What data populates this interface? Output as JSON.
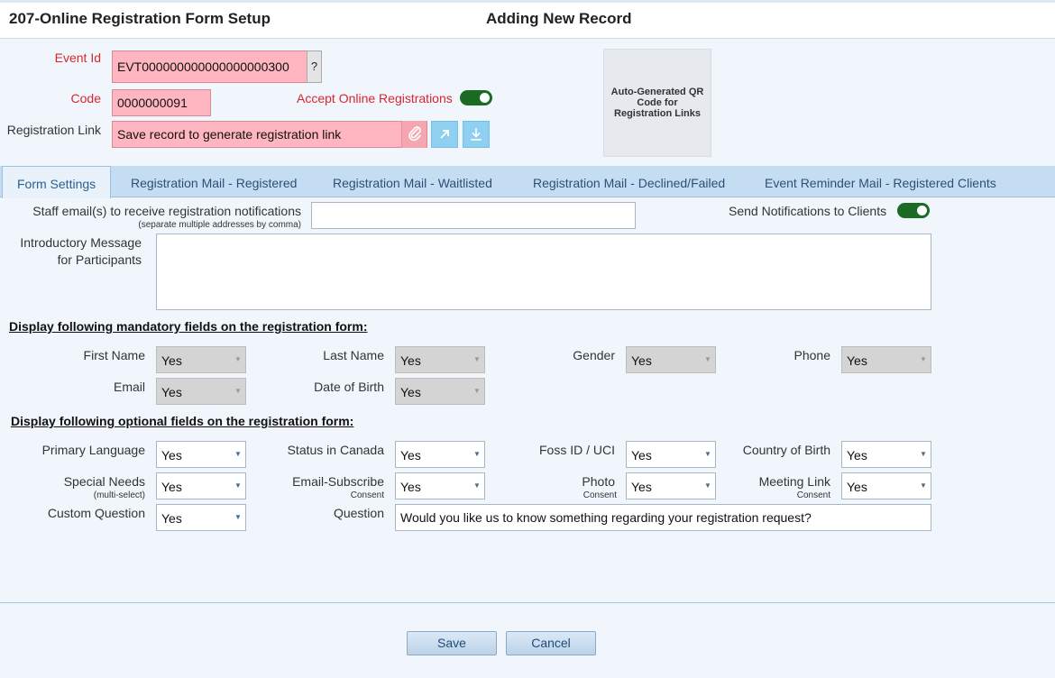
{
  "header": {
    "app_title": "207-Online Registration Form Setup",
    "mode_title": "Adding New Record"
  },
  "record": {
    "event_id_label": "Event Id",
    "event_id_value": "EVT000000000000000000300",
    "help_label": "?",
    "code_label": "Code",
    "code_value": "0000000091",
    "accept_online_label": "Accept Online Registrations",
    "accept_online_on": true,
    "reg_link_label": "Registration Link",
    "reg_link_value": "Save record to generate registration link",
    "qr_text": "Auto-Generated QR Code for Registration Links"
  },
  "tabs": [
    {
      "label": "Form Settings",
      "active": true
    },
    {
      "label": "Registration Mail - Registered",
      "active": false
    },
    {
      "label": "Registration Mail - Waitlisted",
      "active": false
    },
    {
      "label": "Registration Mail - Declined/Failed",
      "active": false
    },
    {
      "label": "Event Reminder Mail - Registered Clients",
      "active": false
    }
  ],
  "form": {
    "staff_email_label": "Staff email(s) to receive registration notifications",
    "staff_email_note": "(separate multiple addresses by comma)",
    "staff_email_value": "",
    "send_notifications_label": "Send Notifications to Clients",
    "send_notifications_on": true,
    "intro_label_1": "Introductory Message",
    "intro_label_2": "for Participants",
    "intro_value": ""
  },
  "mandatory": {
    "heading": "Display following mandatory fields on the registration form:",
    "fields": [
      {
        "label": "First Name",
        "value": "Yes"
      },
      {
        "label": "Last Name",
        "value": "Yes"
      },
      {
        "label": "Gender",
        "value": "Yes"
      },
      {
        "label": "Phone",
        "value": "Yes"
      },
      {
        "label": "Email",
        "value": "Yes"
      },
      {
        "label": "Date of Birth",
        "value": "Yes"
      }
    ]
  },
  "optional": {
    "heading": "Display following optional fields on the registration form:",
    "fields": [
      {
        "label": "Primary Language",
        "sub": "",
        "value": "Yes"
      },
      {
        "label": "Status in Canada",
        "sub": "",
        "value": "Yes"
      },
      {
        "label": "Foss ID / UCI",
        "sub": "",
        "value": "Yes"
      },
      {
        "label": "Country of Birth",
        "sub": "",
        "value": "Yes"
      },
      {
        "label": "Special Needs",
        "sub": "(multi-select)",
        "value": "Yes"
      },
      {
        "label": "Email-Subscribe",
        "sub": "Consent",
        "value": "Yes"
      },
      {
        "label": "Photo",
        "sub": "Consent",
        "value": "Yes"
      },
      {
        "label": "Meeting Link",
        "sub": "Consent",
        "value": "Yes"
      },
      {
        "label": "Custom Question",
        "sub": "",
        "value": "Yes"
      }
    ],
    "question_label": "Question",
    "question_value": "Would you like us to know something regarding your registration request?"
  },
  "footer": {
    "save_label": "Save",
    "cancel_label": "Cancel"
  },
  "icons": {
    "attach": "paperclip-icon",
    "open_link": "arrow-up-right-icon",
    "download": "download-icon"
  },
  "colors": {
    "required_bg": "#ffb6c1",
    "toggle_on": "#1b6b23",
    "tab_bar": "#c5ddf3",
    "label_red": "#d9262e"
  }
}
